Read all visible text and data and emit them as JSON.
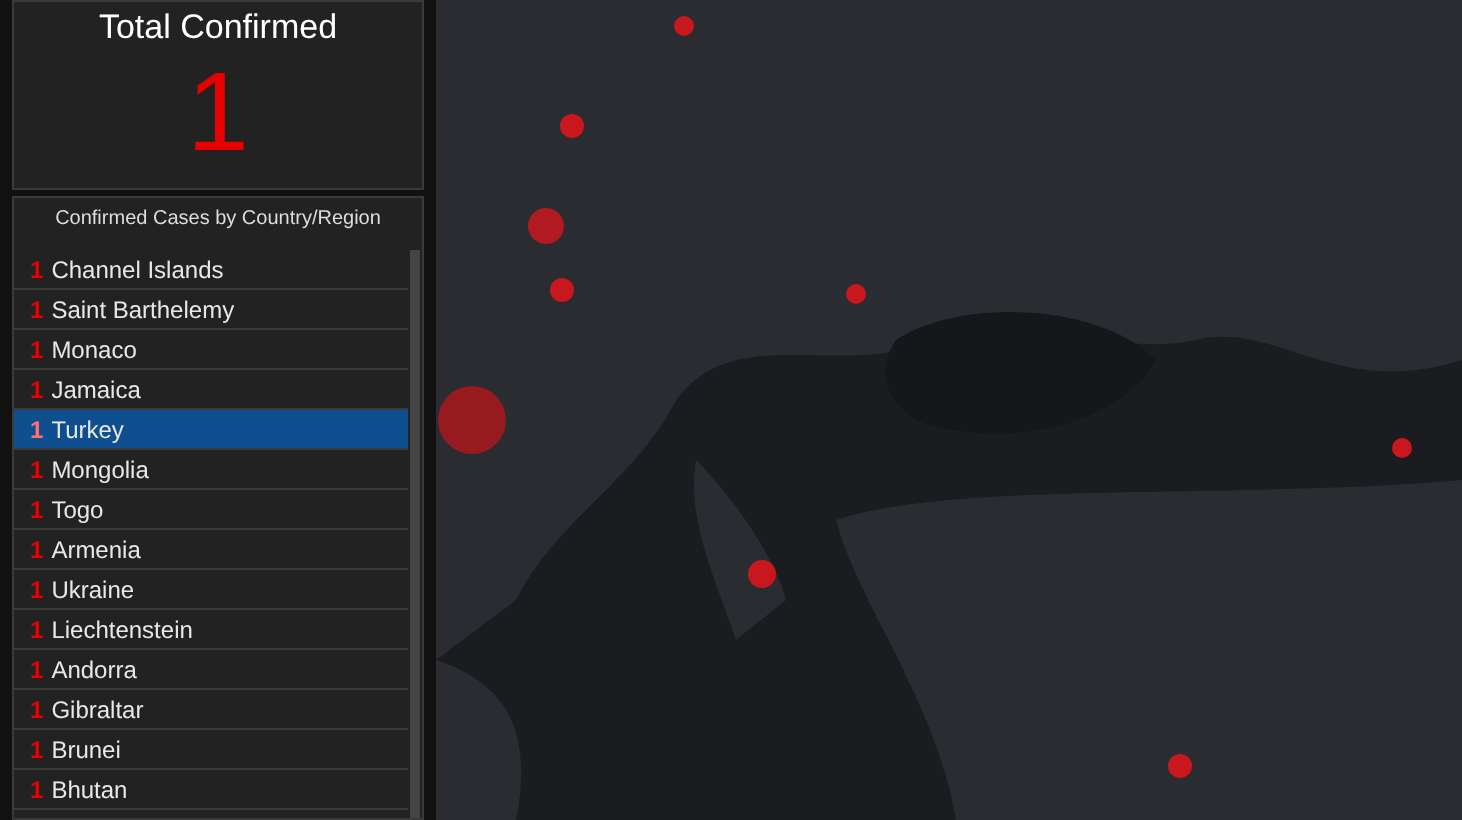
{
  "total_panel": {
    "title": "Total Confirmed",
    "value": "1"
  },
  "cases_list": {
    "title": "Confirmed Cases by Country/Region",
    "rows": [
      {
        "count": "1",
        "name": "Channel Islands",
        "selected": false
      },
      {
        "count": "1",
        "name": "Saint Barthelemy",
        "selected": false
      },
      {
        "count": "1",
        "name": "Monaco",
        "selected": false
      },
      {
        "count": "1",
        "name": "Jamaica",
        "selected": false
      },
      {
        "count": "1",
        "name": "Turkey",
        "selected": true
      },
      {
        "count": "1",
        "name": "Mongolia",
        "selected": false
      },
      {
        "count": "1",
        "name": "Togo",
        "selected": false
      },
      {
        "count": "1",
        "name": "Armenia",
        "selected": false
      },
      {
        "count": "1",
        "name": "Ukraine",
        "selected": false
      },
      {
        "count": "1",
        "name": "Liechtenstein",
        "selected": false
      },
      {
        "count": "1",
        "name": "Andorra",
        "selected": false
      },
      {
        "count": "1",
        "name": "Gibraltar",
        "selected": false
      },
      {
        "count": "1",
        "name": "Brunei",
        "selected": false
      },
      {
        "count": "1",
        "name": "Bhutan",
        "selected": false
      }
    ]
  }
}
